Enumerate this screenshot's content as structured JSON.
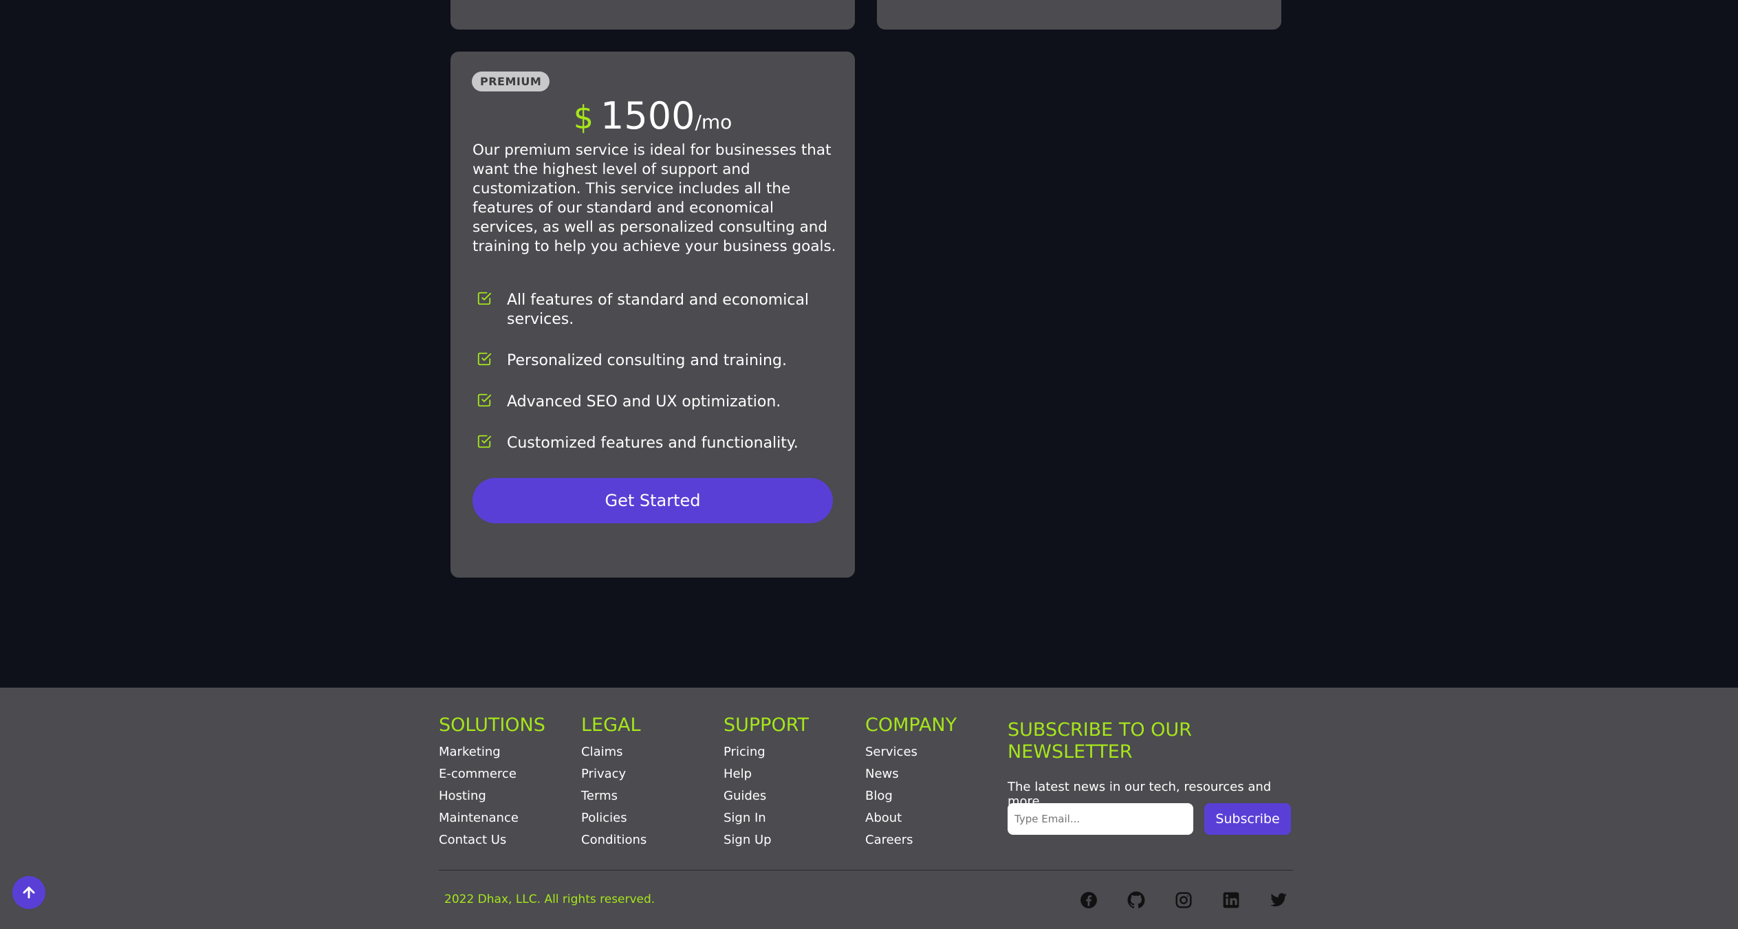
{
  "pricing": {
    "premium": {
      "badge": "PREMIUM",
      "currency": "$",
      "amount": "1500",
      "period": "/mo",
      "description": "Our premium service is ideal for businesses that want the highest level of support and customization. This service includes all the features of our standard and economical services, as well as personalized consulting and training to help you achieve your business goals.",
      "features": [
        "All features of standard and economical services.",
        "Personalized consulting and training.",
        "Advanced SEO and UX optimization.",
        "Customized features and functionality."
      ],
      "cta": "Get Started"
    }
  },
  "footer": {
    "solutions": {
      "title": "SOLUTIONS",
      "links": [
        "Marketing",
        "E-commerce",
        "Hosting",
        "Maintenance",
        "Contact Us"
      ]
    },
    "legal": {
      "title": "LEGAL",
      "links": [
        "Claims",
        "Privacy",
        "Terms",
        "Policies",
        "Conditions"
      ]
    },
    "support": {
      "title": "SUPPORT",
      "links": [
        "Pricing",
        "Help",
        "Guides",
        "Sign In",
        "Sign Up"
      ]
    },
    "company": {
      "title": "COMPANY",
      "links": [
        "Services",
        "News",
        "Blog",
        "About",
        "Careers"
      ]
    },
    "newsletter": {
      "title": "SUBSCRIBE TO OUR NEWSLETTER",
      "text": "The latest news in our tech, resources and more.",
      "placeholder": "Type Email...",
      "button": "Subscribe"
    },
    "copyright": "2022 Dhax, LLC. All rights reserved.",
    "social": [
      "facebook-icon",
      "github-icon",
      "instagram-icon",
      "linkedin-icon",
      "twitter-icon"
    ]
  },
  "colors": {
    "accent": "#a6e61a",
    "primary": "#5a3fd6",
    "card": "#4b4b50",
    "background": "#0f111a"
  }
}
